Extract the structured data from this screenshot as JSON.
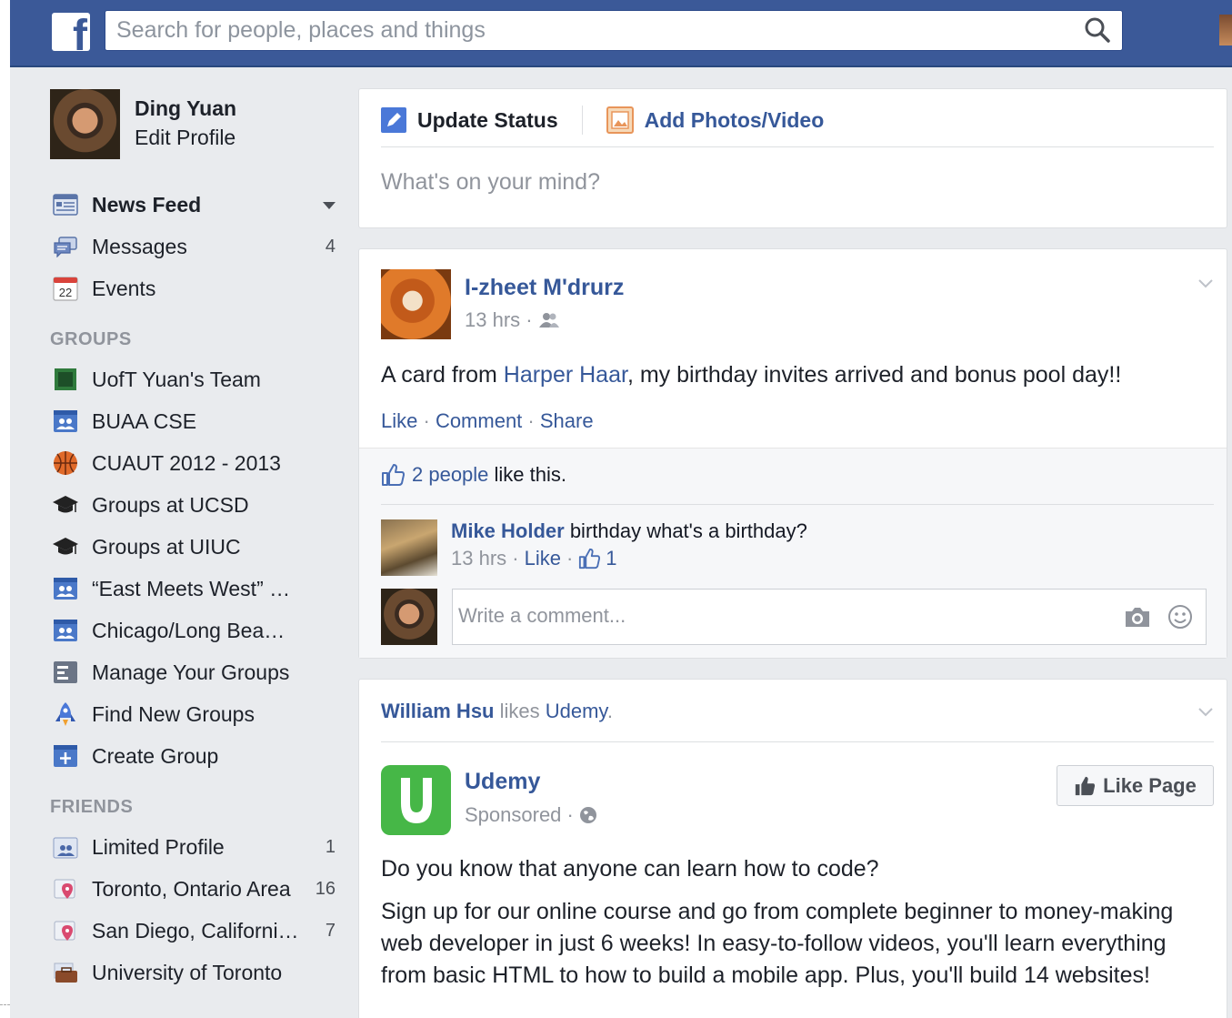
{
  "header": {
    "search_placeholder": "Search for people, places and things"
  },
  "sidebar": {
    "user_name": "Ding Yuan",
    "edit_profile": "Edit Profile",
    "nav": [
      {
        "label": "News Feed",
        "icon": "news-feed-icon"
      },
      {
        "label": "Messages",
        "count": "4",
        "icon": "messages-icon"
      },
      {
        "label": "Events",
        "icon": "calendar-icon",
        "icon_text": "22"
      }
    ],
    "groups_heading": "GROUPS",
    "groups": [
      {
        "label": "UofT Yuan's Team",
        "icon": "group-photo-icon"
      },
      {
        "label": "BUAA CSE",
        "icon": "group-icon"
      },
      {
        "label": "CUAUT 2012 - 2013",
        "icon": "basketball-icon"
      },
      {
        "label": "Groups at UCSD",
        "icon": "graduation-cap-icon"
      },
      {
        "label": "Groups at UIUC",
        "icon": "graduation-cap-icon"
      },
      {
        "label": "“East Meets West” …",
        "icon": "group-icon"
      },
      {
        "label": "Chicago/Long Bea…",
        "icon": "group-icon"
      },
      {
        "label": "Manage Your Groups",
        "icon": "manage-groups-icon"
      },
      {
        "label": "Find New Groups",
        "icon": "rocket-icon"
      },
      {
        "label": "Create Group",
        "icon": "plus-icon"
      }
    ],
    "friends_heading": "FRIENDS",
    "friends": [
      {
        "label": "Limited Profile",
        "count": "1",
        "icon": "friend-list-icon"
      },
      {
        "label": "Toronto, Ontario Area",
        "count": "16",
        "icon": "location-pin-icon"
      },
      {
        "label": "San Diego, Californi…",
        "count": "7",
        "icon": "location-pin-icon"
      },
      {
        "label": "University of Toronto",
        "icon": "briefcase-icon"
      }
    ]
  },
  "composer": {
    "update_status": "Update Status",
    "add_photos": "Add Photos/Video",
    "placeholder": "What's on your mind?"
  },
  "post1": {
    "author": "I-zheet M'drurz",
    "time": "13 hrs ·",
    "text_pre": "A card from ",
    "text_link": "Harper Haar",
    "text_post": ", my birthday invites arrived and bonus pool day!!",
    "like": "Like",
    "comment": "Comment",
    "share": "Share",
    "sep": "·",
    "likes_link": "2 people",
    "likes_rest": " like this.",
    "comment1": {
      "author": "Mike Holder",
      "text": " birthday what's a birthday?",
      "time": "13 hrs ·",
      "like": "Like",
      "sep": "·",
      "like_count": "1"
    },
    "write_placeholder": "Write a comment..."
  },
  "post2": {
    "actor": "William Hsu",
    "verb": " likes ",
    "page": "Udemy",
    "period": ".",
    "page_name": "Udemy",
    "sponsored": "Sponsored ·",
    "like_page": "Like Page",
    "question": "Do you know that anyone can learn how to code?",
    "body": "Sign up for our online course and go from complete beginner to money-making web developer in just 6 weeks! In easy-to-follow videos, you'll learn everything from basic HTML to how to build a mobile app. Plus, you'll build 14 websites!"
  },
  "colors": {
    "brand": "#3b5998",
    "link": "#365899",
    "udemy": "#46b747"
  }
}
